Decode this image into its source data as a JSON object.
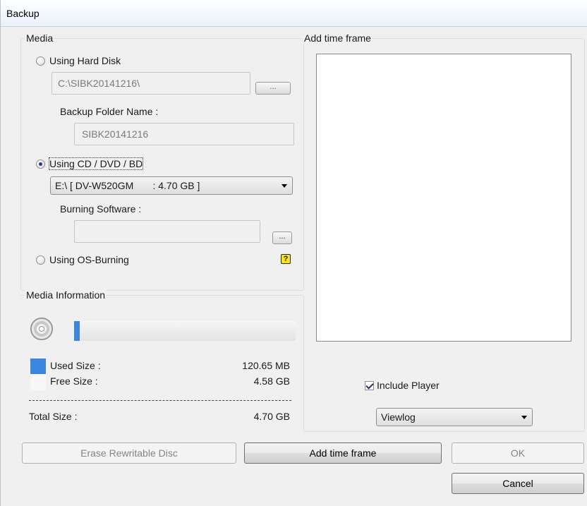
{
  "window": {
    "title": "Backup"
  },
  "media": {
    "group_label": "Media",
    "hard_disk": {
      "label": "Using Hard Disk",
      "checked": false,
      "path_value": "C:\\SIBK20141216\\",
      "browse_label": "...",
      "folder_name_label": "Backup Folder Name :",
      "folder_name_value": "SIBK20141216"
    },
    "cd_dvd": {
      "label": "Using CD / DVD / BD",
      "checked": true,
      "drive_value": "E:\\ [ DV-W520GM       : 4.70 GB ]",
      "burning_software_label": "Burning Software :",
      "burning_software_value": "",
      "browse_label": "..."
    },
    "os_burning": {
      "label": "Using OS-Burning",
      "checked": false,
      "help_icon": "question-icon",
      "help_glyph": "?"
    }
  },
  "media_info": {
    "group_label": "Media Information",
    "disc_icon": "disc-icon",
    "usage_fraction": 0.025,
    "used_label": "Used Size :",
    "used_value": "120.65 MB",
    "used_color": "#3a86e0",
    "free_label": "Free Size :",
    "free_value": "4.58 GB",
    "free_color": "#f7f7f7",
    "total_label": "Total Size :",
    "total_value": "4.70 GB"
  },
  "time_frame": {
    "group_label": "Add time frame",
    "items": [],
    "include_player_label": "Include Player",
    "include_player_checked": true,
    "player_value": "Viewlog"
  },
  "buttons": {
    "erase_label": "Erase Rewritable Disc",
    "add_time_frame_label": "Add time frame",
    "ok_label": "OK",
    "cancel_label": "Cancel"
  }
}
